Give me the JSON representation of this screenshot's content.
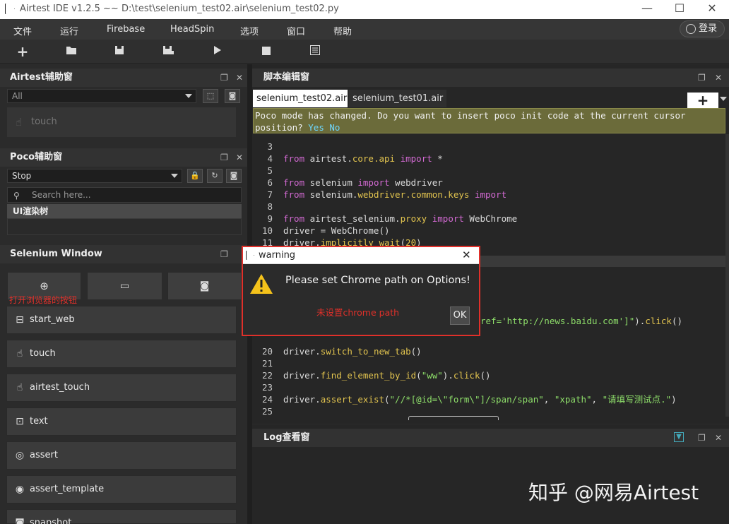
{
  "window": {
    "title": "Airtest IDE v1.2.5 ~~ D:\\test\\selenium_test02.air\\selenium_test02.py"
  },
  "menu": [
    "文件",
    "运行",
    "Firebase",
    "HeadSpin",
    "选项",
    "窗口",
    "帮助"
  ],
  "login_label": "登录",
  "airtest_panel": {
    "title": "Airtest辅助窗",
    "filter_value": "All",
    "touch_label": "touch"
  },
  "poco_panel": {
    "title": "Poco辅助窗",
    "mode_value": "Stop",
    "search_placeholder": "Search here...",
    "tree_root": "UI渲染树"
  },
  "selenium_panel": {
    "title": "Selenium Window",
    "annotation": "打开浏览器的按钮",
    "buttons": [
      "start_web",
      "touch",
      "airtest_touch",
      "text",
      "assert",
      "assert_template",
      "snapshot"
    ]
  },
  "editor": {
    "title": "脚本编辑窗",
    "tabs": [
      "selenium_test02.air",
      "selenium_test01.air"
    ],
    "notice": "Poco mode has changed. Do you want to insert poco init code at the current cursor position?",
    "notice_yes": "Yes",
    "notice_no": "No",
    "visible_fragment": "ref='http://news.baidu.com']\").click()"
  },
  "log_panel": {
    "title": "Log查看窗"
  },
  "dialog": {
    "title": "warning",
    "message": "Please set Chrome path on Options!",
    "annotation": "未设置chrome path",
    "ok_label": "OK"
  },
  "watermark": "知乎 @网易Airtest",
  "colors": {
    "accent_red": "#e0302a",
    "notice_bg": "#6b6b3a",
    "keyword": "#d36ad3",
    "function": "#e2c44f",
    "string": "#8ede6a"
  }
}
